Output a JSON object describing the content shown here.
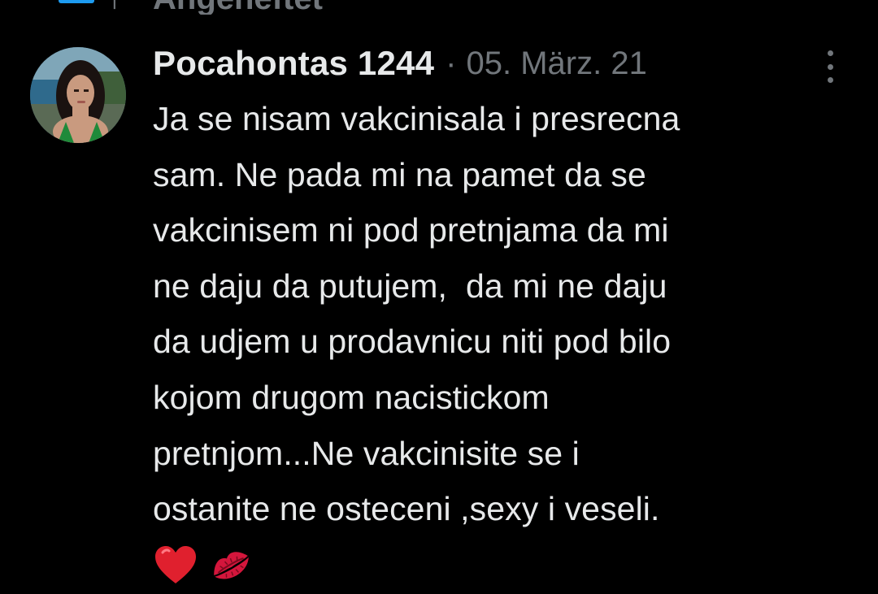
{
  "context": {
    "pinned_label": "Angeheftet",
    "pin_icon": "pin-icon",
    "accent_color": "#1d9bf0"
  },
  "tweet": {
    "author_name": "Pocahontas 1244",
    "separator": "·",
    "timestamp": "05. März. 21",
    "avatar_icon": "user-avatar",
    "more_icon": "more-options-icon",
    "lines": [
      "Ja se nisam vakcinisala i presrecna",
      "sam. Ne pada mi na pamet da se",
      "vakcinisem ni pod pretnjama da mi",
      "ne daju da putujem,  da mi ne daju",
      "da udjem u prodavnicu niti pod bilo",
      "kojom drugom nacistickom",
      "pretnjom...Ne vakcinisite se i",
      "ostanite ne osteceni ,sexy i veseli."
    ],
    "emojis": [
      "red-heart-emoji",
      "kiss-mark-emoji"
    ]
  },
  "colors": {
    "background": "#000000",
    "primary_text": "#e7e9ea",
    "secondary_text": "#71767b",
    "heart": "#e0202e",
    "kiss": "#d4163c"
  }
}
